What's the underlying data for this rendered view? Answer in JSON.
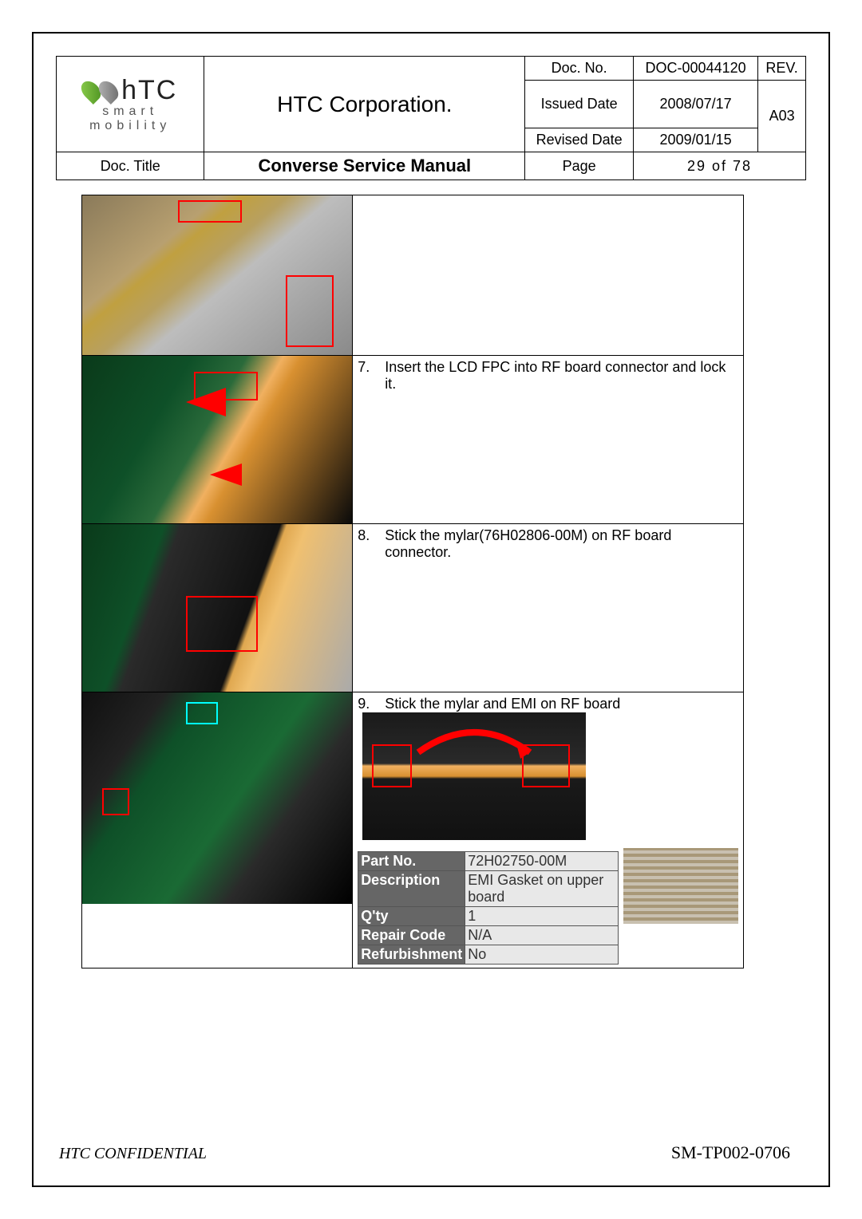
{
  "header": {
    "company": "HTC Corporation.",
    "logo_text": "hTC",
    "logo_sub": "smart mobility",
    "doc_no_label": "Doc. No.",
    "doc_no": "DOC-00044120",
    "rev_label": "REV.",
    "rev": "A03",
    "issued_label": "Issued Date",
    "issued": "2008/07/17",
    "revised_label": "Revised Date",
    "revised": "2009/01/15",
    "doc_title_label": "Doc. Title",
    "doc_title": "Converse Service Manual",
    "page_label": "Page",
    "page": "29  of  78"
  },
  "steps": {
    "s7_num": "7.",
    "s7_text": "Insert the LCD FPC into RF board connector and lock it.",
    "s8_num": "8.",
    "s8_text": "Stick the mylar(76H02806-00M) on RF board connector.",
    "s9_num": "9.",
    "s9_text": "Stick the mylar and EMI on RF board"
  },
  "mini_table": {
    "part_no_label": "Part No.",
    "part_no": "72H02750-00M",
    "desc_label": "Description",
    "desc": "EMI Gasket on upper board",
    "qty_label": "Q'ty",
    "qty": "1",
    "repair_label": "Repair Code",
    "repair": "N/A",
    "refurb_label": "Refurbishment",
    "refurb": "No"
  },
  "footer": {
    "left": "HTC CONFIDENTIAL",
    "right": "SM-TP002-0706"
  }
}
